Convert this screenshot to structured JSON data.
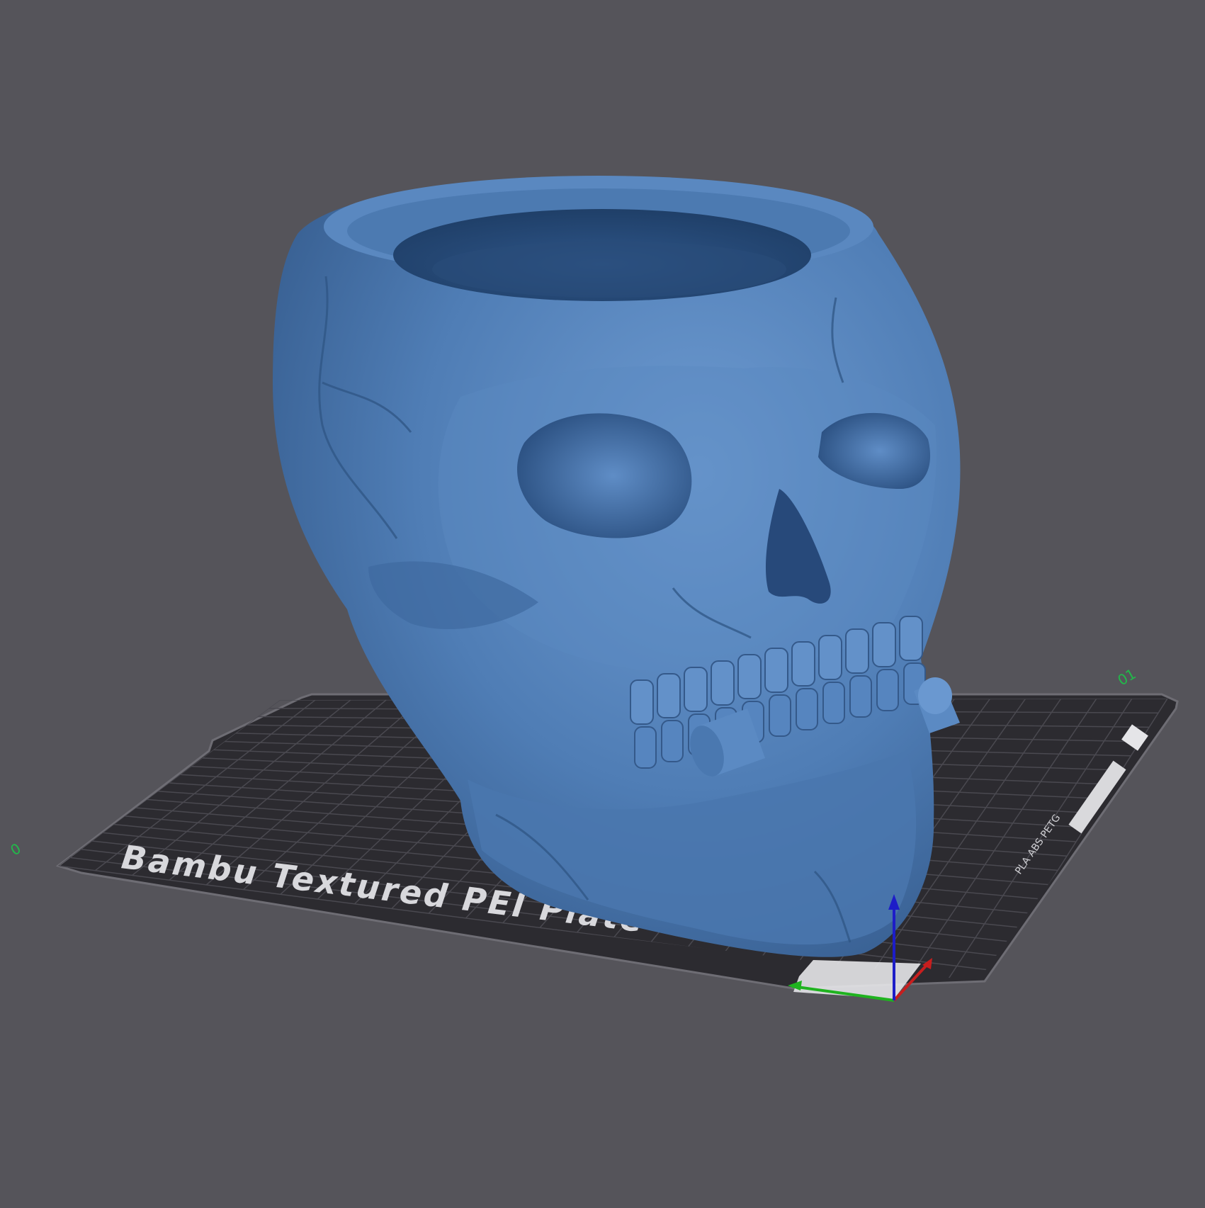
{
  "scene": {
    "background_color": "#55545a",
    "model_color": "#4f7db5",
    "model_name": "skull-planter",
    "bed": {
      "plate_label": "Bambu Textured PEI Plate",
      "corner_label_origin": "0",
      "corner_label_far": "01",
      "side_label": "PLA ABS PETG",
      "bed_color": "#2c2b30",
      "grid_color": "#4a4950",
      "edge_color": "#6e6d74"
    },
    "axes": {
      "x_color": "#c81e1e",
      "y_color": "#1fb31f",
      "z_color": "#1d1dc8"
    }
  }
}
